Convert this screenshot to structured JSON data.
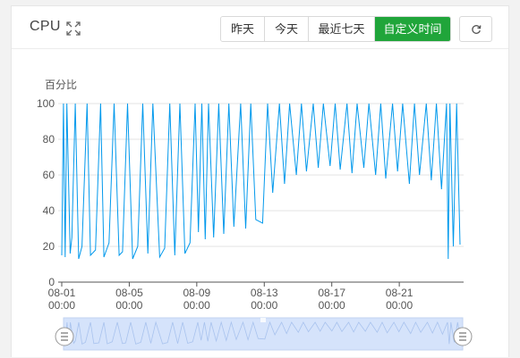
{
  "panel": {
    "title": "CPU",
    "icons": {
      "expand": "expand-icon",
      "refresh": "refresh-icon"
    },
    "range_buttons": [
      {
        "label": "昨天",
        "active": false
      },
      {
        "label": "今天",
        "active": false
      },
      {
        "label": "最近七天",
        "active": false
      },
      {
        "label": "自定义时间",
        "active": true
      }
    ]
  },
  "colors": {
    "series": "#0399ec",
    "accent": "#20a53a",
    "zoom_fill": "#d5e3fb"
  },
  "chart_data": {
    "type": "line",
    "ylabel": "百分比",
    "ylim": [
      0,
      100
    ],
    "yticks": [
      0,
      20,
      40,
      60,
      80,
      100
    ],
    "x_range_days": [
      0,
      23.6
    ],
    "xticks": [
      {
        "day": 0,
        "date": "08-01",
        "time": "00:00"
      },
      {
        "day": 4,
        "date": "08-05",
        "time": "00:00"
      },
      {
        "day": 8,
        "date": "08-09",
        "time": "00:00"
      },
      {
        "day": 12,
        "date": "08-13",
        "time": "00:00"
      },
      {
        "day": 16,
        "date": "08-17",
        "time": "00:00"
      },
      {
        "day": 20,
        "date": "08-21",
        "time": "00:00"
      }
    ],
    "grid": true,
    "legend": "none",
    "series": [
      {
        "x_days": [
          0.0,
          0.1,
          0.2,
          0.3,
          0.5,
          0.6,
          0.8,
          1.0,
          1.2,
          1.5,
          1.7,
          2.0,
          2.3,
          2.5,
          2.8,
          3.1,
          3.4,
          3.6,
          3.9,
          4.2,
          4.5,
          4.8,
          5.1,
          5.4,
          5.8,
          6.1,
          6.4,
          6.7,
          7.0,
          7.3,
          7.6,
          7.9,
          8.1,
          8.3,
          8.5,
          8.7,
          9.0,
          9.3,
          9.6,
          9.9,
          10.2,
          10.6,
          10.9,
          11.2,
          11.5,
          11.9,
          12.2,
          12.5,
          12.9,
          13.2,
          13.5,
          13.9,
          14.2,
          14.5,
          14.9,
          15.2,
          15.5,
          15.9,
          16.2,
          16.5,
          16.9,
          17.2,
          17.5,
          17.9,
          18.2,
          18.6,
          18.9,
          19.2,
          19.6,
          19.9,
          20.2,
          20.6,
          20.9,
          21.2,
          21.6,
          21.9,
          22.2,
          22.5,
          22.8,
          22.9,
          23.0,
          23.2,
          23.4,
          23.6
        ],
        "y": [
          15,
          100,
          14,
          100,
          16,
          25,
          100,
          13,
          20,
          100,
          15,
          18,
          100,
          14,
          22,
          100,
          15,
          17,
          100,
          13,
          20,
          100,
          16,
          100,
          14,
          19,
          100,
          15,
          100,
          16,
          22,
          100,
          28,
          100,
          24,
          100,
          25,
          100,
          27,
          100,
          31,
          100,
          30,
          100,
          35,
          33,
          100,
          50,
          100,
          55,
          100,
          60,
          100,
          62,
          100,
          64,
          100,
          65,
          100,
          63,
          100,
          61,
          100,
          64,
          100,
          60,
          100,
          58,
          100,
          62,
          100,
          55,
          100,
          60,
          100,
          57,
          100,
          52,
          100,
          13,
          100,
          20,
          100,
          21
        ]
      }
    ]
  }
}
